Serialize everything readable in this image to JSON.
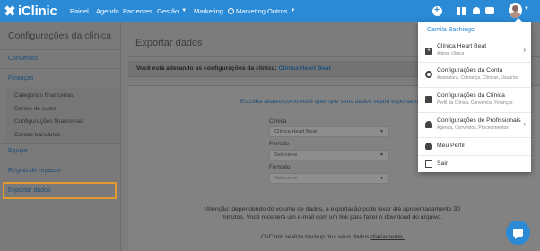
{
  "brand": {
    "logo_text": "iClinic",
    "accent": "#2a8ad6",
    "highlight": "#e39a2d"
  },
  "nav": {
    "items": [
      "Painel",
      "Agenda",
      "Pacientes",
      "Gestão",
      "Marketing",
      "Marketing",
      "Outros"
    ],
    "caret": "▼"
  },
  "topbar_icons": [
    "plus-circle-icon",
    "gift-icon",
    "bell-icon",
    "chat-icon"
  ],
  "sidebar": {
    "title": "Configurações da clínica",
    "convenios": "Convênios",
    "financas": "Finanças",
    "financas_items": [
      "Categorias financeiras",
      "Centro de custo",
      "Configurações financeiras",
      "Contas bancárias"
    ],
    "equipe": "Equipe",
    "regras": "Regras de repasse",
    "exportar": "Exportar dados"
  },
  "main": {
    "title": "Exportar dados",
    "notice_prefix": "Você está alterando as configurações da clínica:",
    "clinic_name": "Clínica Heart Beat",
    "choose_text": "Escolha abaixo como você quer que seus dados sejam exportados",
    "fields": [
      {
        "label": "Clínica",
        "value": "Clínica Heart Beat"
      },
      {
        "label": "Período",
        "value": "Selecione"
      },
      {
        "label": "Formato",
        "value": "Selecione"
      }
    ],
    "attention": "*Atenção: dependendo do volume de dados, a exportação pode levar até aproximadamente 30 minutos. Você receberá um e-mail com um link para fazer o download do arquivo.",
    "backup_text": "O iClinic realiza backup dos seus dados",
    "backup_link": "diariamente."
  },
  "user_menu": {
    "user_name": "Camila Bachiego",
    "items": [
      {
        "title": "Clínica Heart Beat",
        "subtitle": "Alterar clínica",
        "arrow": "›"
      },
      {
        "title": "Configurações da Conta",
        "subtitle": "Assinatura, Cobrança, Clínicas, Usuários"
      },
      {
        "title": "Configurações da Clínica",
        "subtitle": "Perfil da Clínica, Convênios, Finanças"
      },
      {
        "title": "Configurações de Profissionais",
        "subtitle": "Agenda, Convênios, Procedimentos",
        "arrow": "›"
      },
      {
        "title": "Meu Perfil"
      },
      {
        "title": "Sair"
      }
    ]
  }
}
